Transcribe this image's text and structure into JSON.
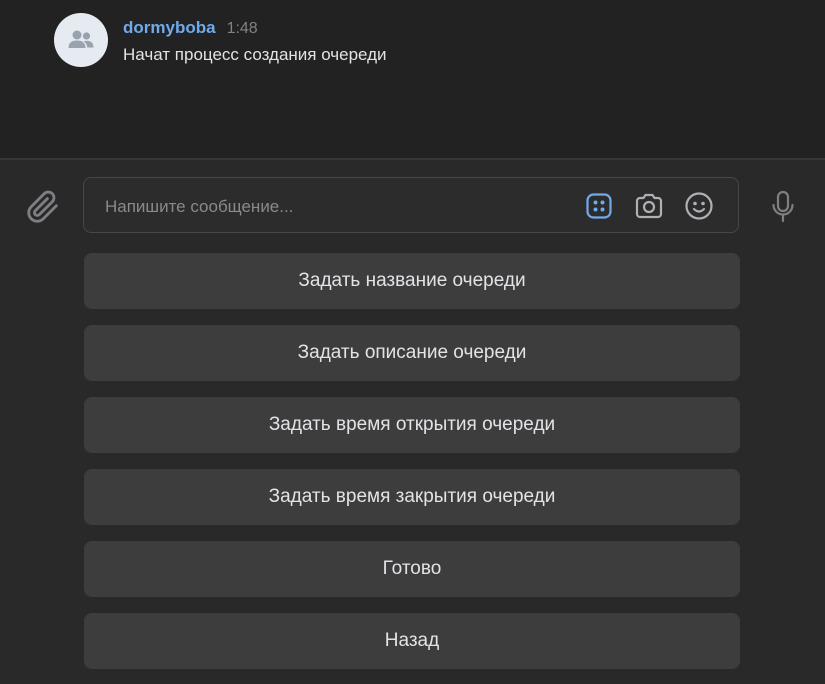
{
  "message": {
    "author": "dormyboba",
    "time": "1:48",
    "text": "Начат процесс создания очереди",
    "avatar_icon": "users-icon"
  },
  "composer": {
    "placeholder": "Напишите сообщение...",
    "icons": [
      "paperclip-icon",
      "bot-keyboard-icon",
      "camera-icon",
      "smile-icon",
      "microphone-icon"
    ],
    "accent_color": "#71aaeb"
  },
  "keyboard": {
    "buttons": [
      "Задать название очереди",
      "Задать описание очереди",
      "Задать время открытия очереди",
      "Задать время закрытия очереди",
      "Готово",
      "Назад"
    ]
  }
}
